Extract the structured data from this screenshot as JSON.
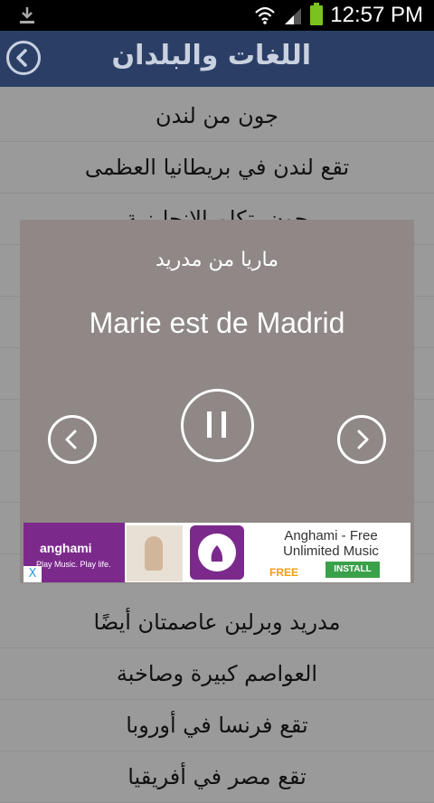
{
  "status_bar": {
    "time": "12:57 PM"
  },
  "header": {
    "title": "اللغات والبلدان"
  },
  "list": [
    "جون من لندن",
    "تقع لندن في بريطانيا العظمى",
    "جون يتكلم الانجليزية",
    "",
    "",
    "",
    "",
    "",
    "",
    "مدريد وبرلين عاصمتان أيضًا",
    "العواصم كبيرة وصاخبة",
    "تقع فرنسا في أوروبا",
    "تقع مصر في أفريقيا"
  ],
  "dialog": {
    "arabic_phrase": "ماريا من مدريد",
    "french_phrase": "Marie est de Madrid"
  },
  "ad": {
    "brand": "anghami",
    "tagline": "Play Music. Play life.",
    "title": "Anghami - Free Unlimited Music",
    "free_label": "FREE",
    "install_label": "INSTALL",
    "close_label": "X"
  },
  "colors": {
    "header_bg": "#2b3f66",
    "list_bg": "#9a9a9a",
    "dialog_bg": "#8f8887",
    "ad_purple": "#7b2a8c"
  }
}
